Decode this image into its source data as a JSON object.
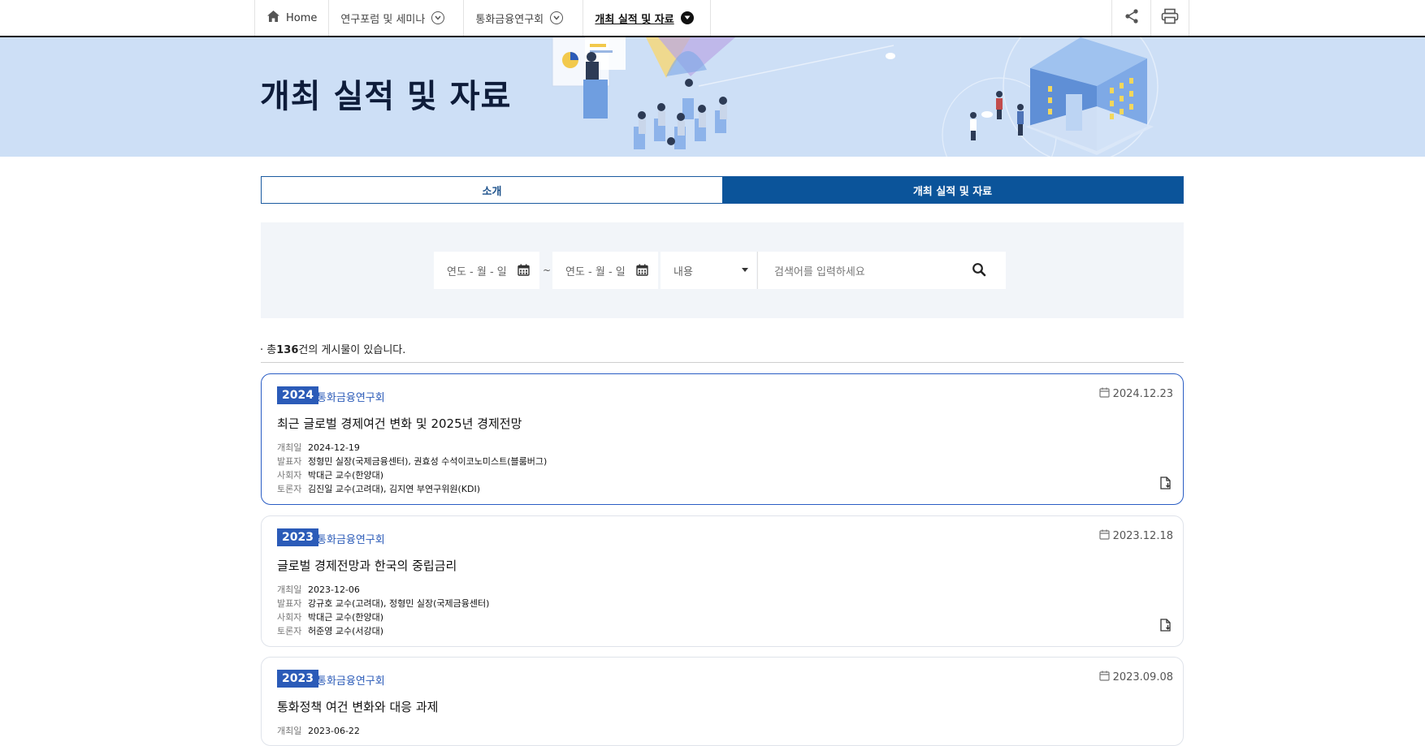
{
  "nav": {
    "home": "Home",
    "items": [
      "연구포럼 및 세미나",
      "통화금융연구회",
      "개최 실적 및 자료"
    ]
  },
  "banner": {
    "title": "개최 실적 및 자료"
  },
  "tabs": [
    "소개",
    "개최 실적 및 자료"
  ],
  "search": {
    "date_from_placeholder": "연도 - 월 - 일",
    "date_to_placeholder": "연도 - 월 - 일",
    "separator": "~",
    "select_value": "내용",
    "keyword_placeholder": "검색어를 입력하세요"
  },
  "count": {
    "prefix": "· 총",
    "number": "136",
    "suffix": "건의 게시물이 있습니다."
  },
  "meta_labels": {
    "date": "개최일",
    "presenter": "발표자",
    "moderator": "사회자",
    "panel": "토론자"
  },
  "posts": [
    {
      "year": "2024",
      "category": "통화금융연구회",
      "posted": "2024.12.23",
      "title": "최근 글로벌 경제여건 변화 및 2025년 경제전망",
      "held": "2024-12-19",
      "presenter": "정형민 실장(국제금융센터), 권효성 수석이코노미스트(블룸버그)",
      "moderator": "박대근 교수(한양대)",
      "panel": "김진일 교수(고려대), 김지연 부연구위원(KDI)"
    },
    {
      "year": "2023",
      "category": "통화금융연구회",
      "posted": "2023.12.18",
      "title": "글로벌 경제전망과 한국의 중립금리",
      "held": "2023-12-06",
      "presenter": "강규호 교수(고려대), 정형민 실장(국제금융센터)",
      "moderator": "박대근 교수(한양대)",
      "panel": "허준영 교수(서강대)"
    },
    {
      "year": "2023",
      "category": "통화금융연구회",
      "posted": "2023.09.08",
      "title": "통화정책 여건 변화와 대응 과제",
      "held": "2023-06-22"
    }
  ],
  "colors": {
    "primary": "#0b549a",
    "badge": "#2b5bb8",
    "banner_bg": "#cddff6"
  },
  "icons": [
    "home-icon",
    "chevron-down-icon",
    "share-icon",
    "print-icon",
    "calendar-icon",
    "search-icon",
    "file-download-icon"
  ]
}
